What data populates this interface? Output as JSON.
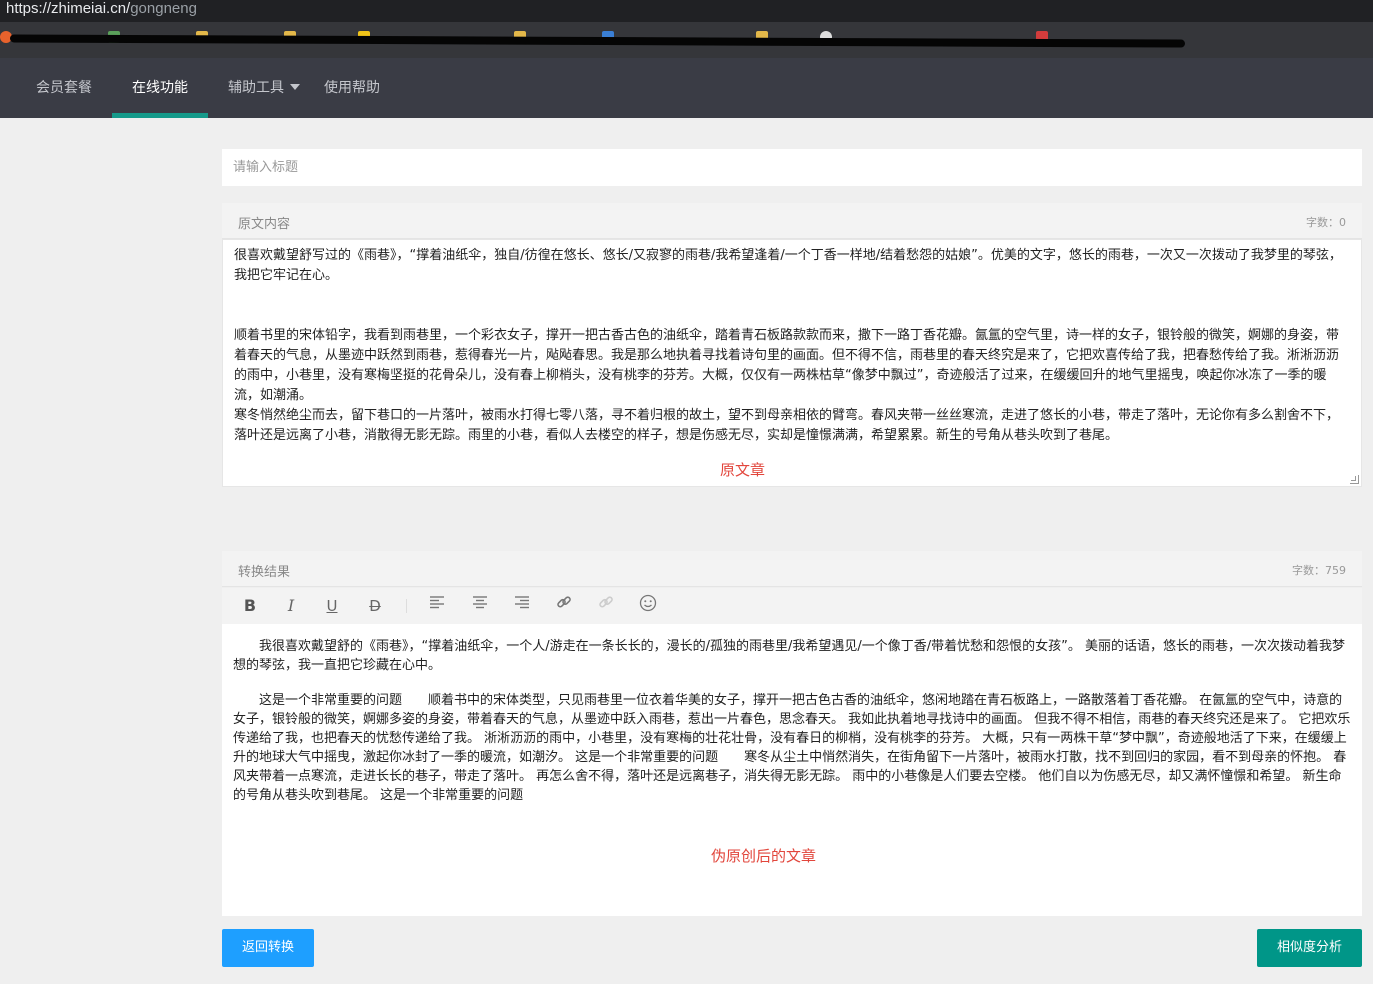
{
  "browser": {
    "url_host": "https://zhimeiai.cn/",
    "url_path": "gongneng"
  },
  "nav": {
    "items": [
      {
        "label": "会员套餐"
      },
      {
        "label": "在线功能"
      },
      {
        "label": "辅助工具"
      },
      {
        "label": "使用帮助"
      }
    ],
    "active_index": 1
  },
  "title_input": {
    "placeholder": "请输入标题",
    "value": ""
  },
  "original": {
    "header": "原文内容",
    "count": "字数：0",
    "paragraphs": [
      "很喜欢戴望舒写过的《雨巷》，“撑着油纸伞，独自/彷徨在悠长、悠长/又寂寥的雨巷/我希望逢着/一个丁香一样地/结着愁怨的姑娘”。优美的文字，悠长的雨巷，一次又一次拨动了我梦里的琴弦，我把它牢记在心。",
      "顺着书里的宋体铅字，我看到雨巷里，一个彩衣女子，撑开一把古香古色的油纸伞，踏着青石板路款款而来，撒下一路丁香花瓣。氤氲的空气里，诗一样的女子，银铃般的微笑，婀娜的身姿，带着春天的气息，从墨迹中跃然到雨巷，惹得春光一片，飐飐春思。我是那么地执着寻找着诗句里的画面。但不得不信，雨巷里的春天终究是来了，它把欢喜传给了我，把春愁传给了我。淅淅沥沥的雨中，小巷里，没有寒梅坚挺的花骨朵儿，没有春上柳梢头，没有桃李的芬芳。大概，仅仅有一两株枯草“像梦中飘过”，奇迹般活了过来，在缓缓回升的地气里摇曳，唤起你冰冻了一季的暖流，如潮涌。",
      "寒冬悄然绝尘而去，留下巷口的一片落叶，被雨水打得七零八落，寻不着归根的故土，望不到母亲相依的臂弯。春风夹带一丝丝寒流，走进了悠长的小巷，带走了落叶，无论你有多么割舍不下，落叶还是远离了小巷，消散得无影无踪。雨里的小巷，看似人去楼空的样子，想是伤感无尽，实却是憧憬满满，希望累累。新生的号角从巷头吹到了巷尾。"
    ],
    "annotation": "原文章"
  },
  "result": {
    "header": "转换结果",
    "count": "字数：759",
    "toolbar": [
      "bold-icon",
      "italic-icon",
      "underline-icon",
      "strikethrough-icon",
      "align-left-icon",
      "align-center-icon",
      "align-right-icon",
      "link-icon",
      "unlink-icon",
      "emoji-icon"
    ],
    "paragraphs": [
      "我很喜欢戴望舒的《雨巷》，“撑着油纸伞，一个人/游走在一条长长的，漫长的/孤独的雨巷里/我希望遇见/一个像丁香/带着忧愁和怨恨的女孩”。 美丽的话语，悠长的雨巷，一次次拨动着我梦想的琴弦，我一直把它珍藏在心中。",
      "这是一个非常重要的问题　　顺着书中的宋体类型，只见雨巷里一位衣着华美的女子，撑开一把古色古香的油纸伞，悠闲地踏在青石板路上，一路散落着丁香花瓣。 在氤氲的空气中，诗意的女子，银铃般的微笑，婀娜多姿的身姿，带着春天的气息，从墨迹中跃入雨巷，惹出一片春色，思念春天。 我如此执着地寻找诗中的画面。 但我不得不相信，雨巷的春天终究还是来了。 它把欢乐传递给了我，也把春天的忧愁传递给了我。 淅淅沥沥的雨中，小巷里，没有寒梅的壮花壮骨，没有春日的柳梢，没有桃李的芬芳。 大概，只有一两株干草“梦中飘”，奇迹般地活了下来，在缓缓上升的地球大气中摇曳，激起你冰封了一季的暖流，如潮汐。 这是一个非常重要的问题　　寒冬从尘土中悄然消失，在街角留下一片落叶，被雨水打散，找不到回归的家园，看不到母亲的怀抱。 春风夹带着一点寒流，走进长长的巷子，带走了落叶。 再怎么舍不得，落叶还是远离巷子，消失得无影无踪。 雨中的小巷像是人们要去空楼。 他们自以为伤感无尽，却又满怀憧憬和希望。 新生命的号角从巷头吹到巷尾。 这是一个非常重要的问题"
    ],
    "annotation": "伪原创后的文章"
  },
  "buttons": {
    "back": "返回转换",
    "similarity": "相似度分析"
  },
  "colors": {
    "nav_bg": "#3a3c45",
    "nav_active_underline": "#159a8a",
    "annotation_red": "#e2463c",
    "back_button": "#1e9fff",
    "similarity_button": "#009688"
  }
}
